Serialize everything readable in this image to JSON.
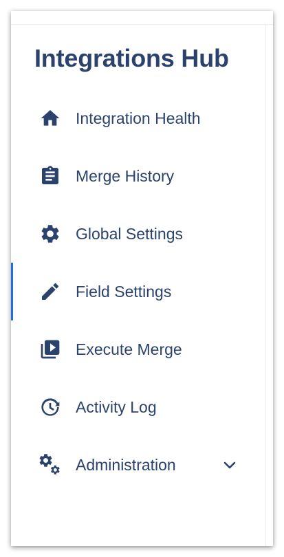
{
  "sidebar": {
    "title": "Integrations Hub",
    "accent_color": "#1e6fd9",
    "text_color": "#2b426d",
    "items": [
      {
        "label": "Integration Health",
        "icon": "home-icon",
        "active": false
      },
      {
        "label": "Merge History",
        "icon": "clipboard-icon",
        "active": false
      },
      {
        "label": "Global Settings",
        "icon": "gear-icon",
        "active": false
      },
      {
        "label": "Field Settings",
        "icon": "pencil-icon",
        "active": true
      },
      {
        "label": "Execute Merge",
        "icon": "video-library-icon",
        "active": false
      },
      {
        "label": "Activity Log",
        "icon": "history-icon",
        "active": false
      },
      {
        "label": "Administration",
        "icon": "gears-icon",
        "active": false,
        "expandable": true,
        "chevron_icon": "chevron-down-icon"
      }
    ]
  }
}
